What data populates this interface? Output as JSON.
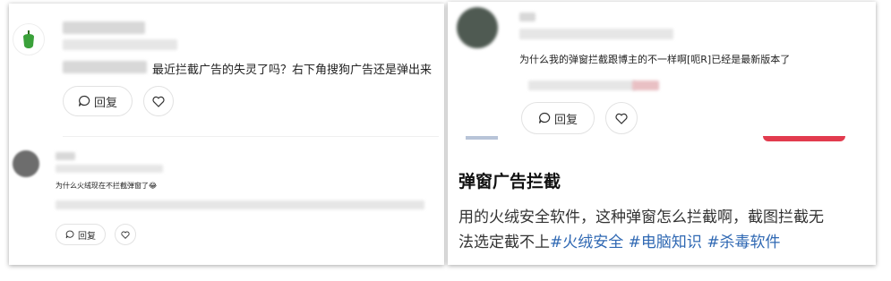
{
  "left_post": {
    "comment1": {
      "text": "最近拦截广告的失灵了吗？右下角搜狗广告还是弹出来",
      "reply_label": "回复"
    },
    "comment2": {
      "text": "为什么火绒现在不拦截弹窗了😂",
      "reply_label": "回复"
    }
  },
  "right_post": {
    "comment": {
      "text": "为什么我的弹窗拦截跟博主的不一样啊[呃R]已经是最新版本了",
      "reply_label": "回复"
    },
    "title": "弹窗广告拦截",
    "body_line1": "用的火绒安全软件，这种弹窗怎么拦截啊，截图拦截无",
    "body_line2_prefix": "法选定截不上",
    "tags": [
      "#火绒安全",
      "#电脑知识",
      "#杀毒软件"
    ]
  },
  "colors": {
    "tag": "#2f68b3",
    "accent_red": "#e23b4e",
    "avatar_green": "#2f9a3a"
  },
  "icons": [
    "comment-bubble-icon",
    "heart-icon"
  ]
}
